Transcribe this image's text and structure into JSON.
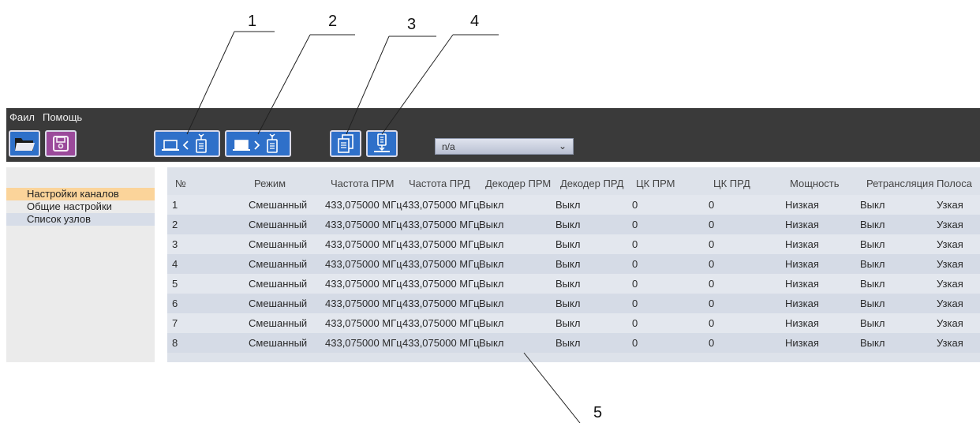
{
  "callouts": [
    "1",
    "2",
    "3",
    "4",
    "5"
  ],
  "menu": [
    "Фаил",
    "Помощь"
  ],
  "toolbar": {
    "open_icon": "folder-open-icon",
    "save_icon": "floppy-disk-icon",
    "read_icon": "computer-from-radio-icon",
    "write_icon": "computer-to-radio-icon",
    "copy_icon": "copy-documents-icon",
    "download_icon": "download-to-device-icon",
    "select_value": "n/a"
  },
  "sidebar": {
    "items": [
      "Настройки каналов",
      "Общие настройки",
      "Список узлов"
    ]
  },
  "table": {
    "headers": [
      "№",
      "Режим",
      "Частота ПРМ",
      "Частота ПРД",
      "Декодер ПРМ",
      "Декодер ПРД",
      "ЦК ПРМ",
      "ЦК ПРД",
      "Мощность",
      "Ретрансляция",
      "Полоса"
    ],
    "rows": [
      [
        "1",
        "Смешанный",
        "433,075000 МГц",
        "433,075000 МГц",
        "Выкл",
        "Выкл",
        "0",
        "0",
        "Низкая",
        "Выкл",
        "Узкая"
      ],
      [
        "2",
        "Смешанный",
        "433,075000 МГц",
        "433,075000 МГц",
        "Выкл",
        "Выкл",
        "0",
        "0",
        "Низкая",
        "Выкл",
        "Узкая"
      ],
      [
        "3",
        "Смешанный",
        "433,075000 МГц",
        "433,075000 МГц",
        "Выкл",
        "Выкл",
        "0",
        "0",
        "Низкая",
        "Выкл",
        "Узкая"
      ],
      [
        "4",
        "Смешанный",
        "433,075000 МГц",
        "433,075000 МГц",
        "Выкл",
        "Выкл",
        "0",
        "0",
        "Низкая",
        "Выкл",
        "Узкая"
      ],
      [
        "5",
        "Смешанный",
        "433,075000 МГц",
        "433,075000 МГц",
        "Выкл",
        "Выкл",
        "0",
        "0",
        "Низкая",
        "Выкл",
        "Узкая"
      ],
      [
        "6",
        "Смешанный",
        "433,075000 МГц",
        "433,075000 МГц",
        "Выкл",
        "Выкл",
        "0",
        "0",
        "Низкая",
        "Выкл",
        "Узкая"
      ],
      [
        "7",
        "Смешанный",
        "433,075000 МГц",
        "433,075000 МГц",
        "Выкл",
        "Выкл",
        "0",
        "0",
        "Низкая",
        "Выкл",
        "Узкая"
      ],
      [
        "8",
        "Смешанный",
        "433,075000 МГц",
        "433,075000 МГц",
        "Выкл",
        "Выкл",
        "0",
        "0",
        "Низкая",
        "Выкл",
        "Узкая"
      ]
    ]
  },
  "colors": {
    "toolbar_bg": "#3a3a3a",
    "button_blue": "#2f70c9",
    "button_purple": "#9b4a9b",
    "sidebar_active": "#fbd49a",
    "grid_bg": "#dde2ea"
  }
}
